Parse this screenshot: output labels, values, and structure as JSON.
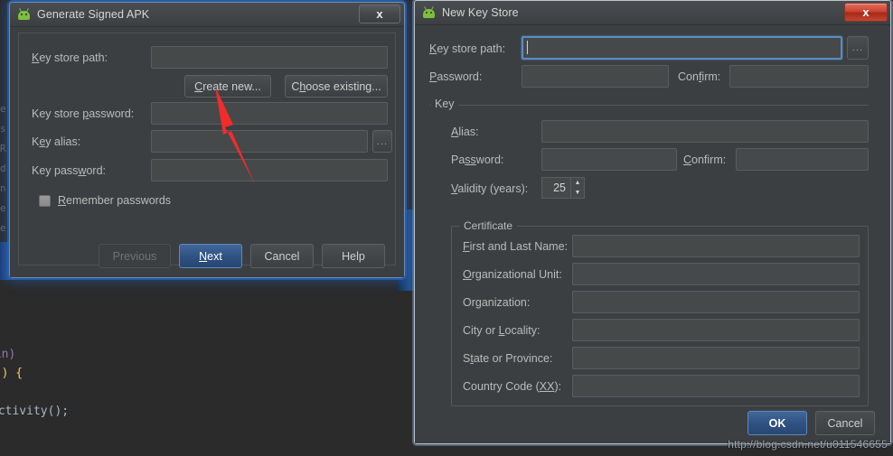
{
  "background": {
    "code_lines": [
      "gin)",
      "y() {",
      "",
      "Activity();"
    ],
    "gutter_chars": "e\ns\nR\nd\nn\ne\ne"
  },
  "signed_apk_dialog": {
    "title": "Generate Signed APK",
    "icon": "android-icon",
    "close_label": "x",
    "fields": {
      "key_store_path": {
        "label": "Key store path:",
        "mnemonic": "K",
        "value": ""
      },
      "key_store_password": {
        "label": "Key store password:",
        "mnemonic": "p",
        "value": ""
      },
      "key_alias": {
        "label": "Key alias:",
        "mnemonic": "e",
        "value": ""
      },
      "key_password": {
        "label": "Key password:",
        "mnemonic": "w",
        "value": ""
      }
    },
    "browse_ellipsis": "...",
    "create_new_button": {
      "label": "Create new...",
      "mnemonic": "C"
    },
    "choose_existing_button": {
      "label": "Choose existing...",
      "mnemonic": "h"
    },
    "remember_passwords": {
      "label": "Remember passwords",
      "mnemonic": "R",
      "checked": false
    },
    "buttons": {
      "previous": {
        "label": "Previous",
        "enabled": false
      },
      "next": {
        "label": "Next",
        "mnemonic": "N",
        "default": true
      },
      "cancel": {
        "label": "Cancel"
      },
      "help": {
        "label": "Help"
      }
    }
  },
  "new_key_store_dialog": {
    "title": "New Key Store",
    "icon": "android-icon",
    "close_label": "x",
    "key_store_path": {
      "label": "Key store path:",
      "mnemonic": "K",
      "value": "",
      "focused": true
    },
    "browse_ellipsis": "...",
    "password": {
      "label": "Password:",
      "mnemonic": "P",
      "value": ""
    },
    "confirm": {
      "label": "Confirm:",
      "mnemonic": "f",
      "value": ""
    },
    "key_group": {
      "title": "Key",
      "alias": {
        "label": "Alias:",
        "mnemonic": "A",
        "value": ""
      },
      "password": {
        "label": "Password:",
        "mnemonic": "ss",
        "value": ""
      },
      "confirm": {
        "label": "Confirm:",
        "mnemonic": "C",
        "value": ""
      },
      "validity": {
        "label": "Validity (years):",
        "mnemonic": "V",
        "value": "25"
      }
    },
    "certificate_group": {
      "title": "Certificate",
      "rows": [
        {
          "label": "First and Last Name:",
          "mnemonic": "F",
          "value": ""
        },
        {
          "label": "Organizational Unit:",
          "mnemonic": "O",
          "value": ""
        },
        {
          "label": "Organization:",
          "mnemonic": "g",
          "value": ""
        },
        {
          "label": "City or Locality:",
          "mnemonic": "L",
          "value": ""
        },
        {
          "label": "State or Province:",
          "mnemonic": "t",
          "value": ""
        },
        {
          "label": "Country Code (XX):",
          "mnemonic": "XX",
          "value": ""
        }
      ]
    },
    "buttons": {
      "ok": {
        "label": "OK",
        "default": true
      },
      "cancel": {
        "label": "Cancel"
      }
    }
  },
  "annotation": {
    "arrow_color": "#f42b2b",
    "points_to": "create-new-button"
  },
  "watermark": {
    "text": "http://blog.csdn.net/u011546655"
  },
  "colors": {
    "dialog_bg": "#3c3f41",
    "field_bg": "#45494a",
    "text": "#bbbbbb",
    "accent_blue": "#2f5182",
    "focus_border": "#5a8cc4",
    "close_red": "#cf4430",
    "android_green": "#7cbf3f"
  }
}
